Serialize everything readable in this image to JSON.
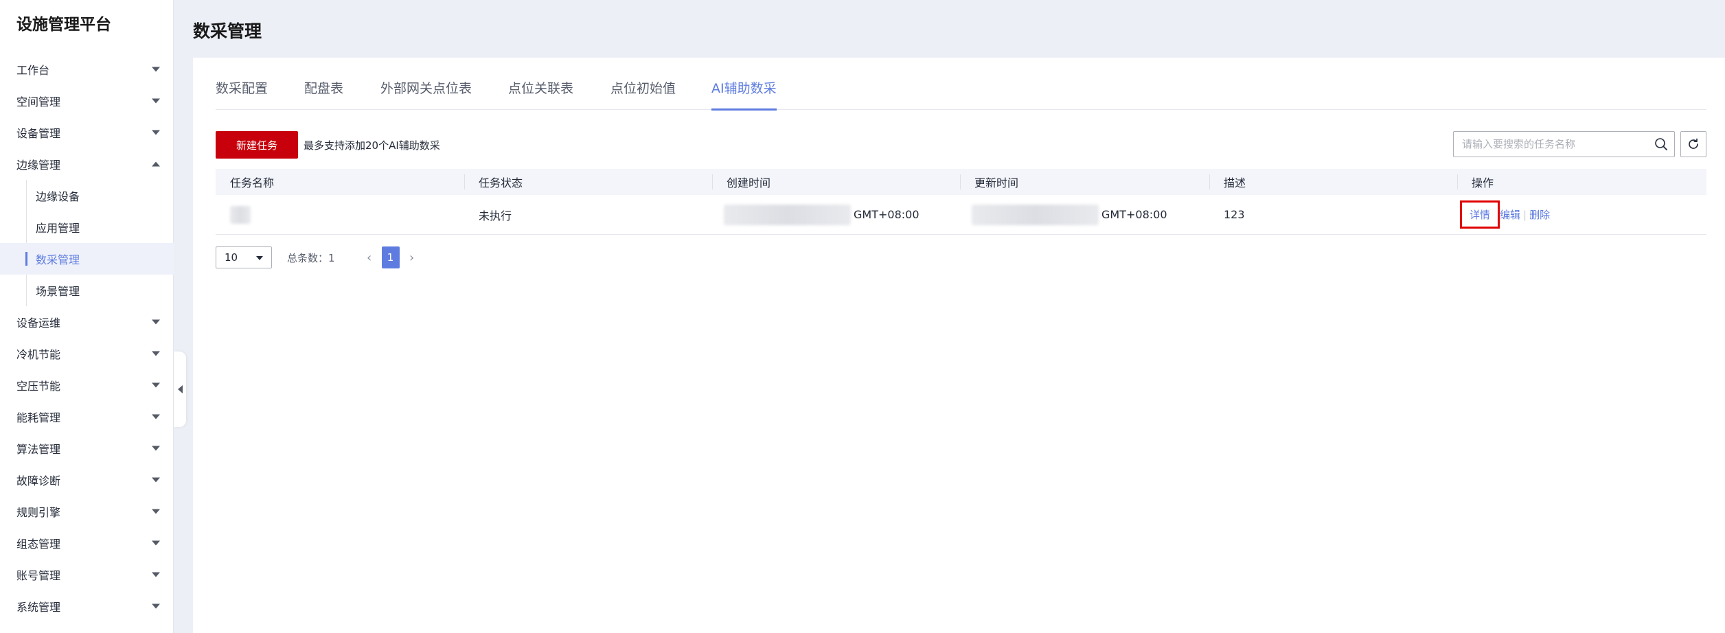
{
  "brand": "设施管理平台",
  "page_title": "数采管理",
  "sidebar": {
    "items_top": [
      {
        "label": "工作台"
      },
      {
        "label": "空间管理"
      },
      {
        "label": "设备管理"
      },
      {
        "label": "边缘管理"
      }
    ],
    "submenu": [
      {
        "label": "边缘设备"
      },
      {
        "label": "应用管理"
      },
      {
        "label": "数采管理"
      },
      {
        "label": "场景管理"
      }
    ],
    "items_bottom": [
      {
        "label": "设备运维"
      },
      {
        "label": "冷机节能"
      },
      {
        "label": "空压节能"
      },
      {
        "label": "能耗管理"
      },
      {
        "label": "算法管理"
      },
      {
        "label": "故障诊断"
      },
      {
        "label": "规则引擎"
      },
      {
        "label": "组态管理"
      },
      {
        "label": "账号管理"
      },
      {
        "label": "系统管理"
      }
    ]
  },
  "tabs": [
    {
      "label": "数采配置"
    },
    {
      "label": "配盘表"
    },
    {
      "label": "外部网关点位表"
    },
    {
      "label": "点位关联表"
    },
    {
      "label": "点位初始值"
    },
    {
      "label": "AI辅助数采"
    }
  ],
  "toolbar": {
    "new_button": "新建任务",
    "tip": "最多支持添加20个AI辅助数采",
    "search_placeholder": "请输入要搜索的任务名称"
  },
  "table": {
    "headers": [
      "任务名称",
      "任务状态",
      "创建时间",
      "更新时间",
      "描述",
      "操作"
    ],
    "rows": [
      {
        "status": "未执行",
        "created_suffix": "GMT+08:00",
        "updated_suffix": "GMT+08:00",
        "description": "123",
        "actions": {
          "detail": "详情",
          "edit": "编辑",
          "delete": "删除",
          "sep": "|"
        }
      }
    ]
  },
  "pagination": {
    "page_size": "10",
    "total": "总条数：1",
    "current_page": "1",
    "prev": "‹",
    "next": "›"
  },
  "colors": {
    "primary": "#5e7ce0",
    "danger_button": "#c7000b",
    "highlight_box": "#e00000"
  }
}
